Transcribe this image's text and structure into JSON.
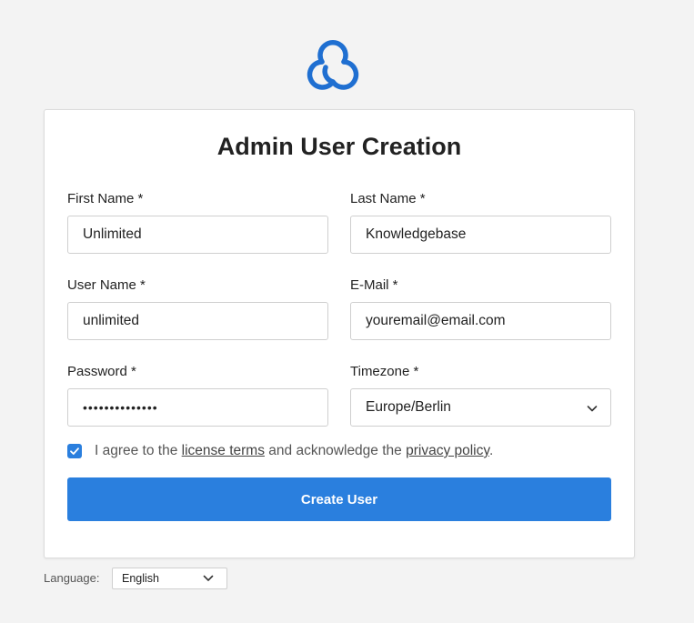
{
  "brand": {
    "logo_icon": "cloud-logo-icon",
    "accent": "#2a7fde"
  },
  "form": {
    "title": "Admin User Creation",
    "first_name": {
      "label": "First Name *",
      "value": "Unlimited"
    },
    "last_name": {
      "label": "Last Name *",
      "value": "Knowledgebase"
    },
    "user_name": {
      "label": "User Name *",
      "value": "unlimited"
    },
    "email": {
      "label": "E-Mail *",
      "value": "youremail@email.com"
    },
    "password": {
      "label": "Password *",
      "value": "••••••••••••••"
    },
    "timezone": {
      "label": "Timezone *",
      "value": "Europe/Berlin"
    },
    "agreement": {
      "checked": true,
      "prefix": "I agree to the ",
      "license_link": "license terms",
      "middle": " and acknowledge the ",
      "privacy_link": "privacy policy",
      "suffix": "."
    },
    "submit_label": "Create User"
  },
  "footer": {
    "language_label": "Language:",
    "language_value": "English"
  }
}
